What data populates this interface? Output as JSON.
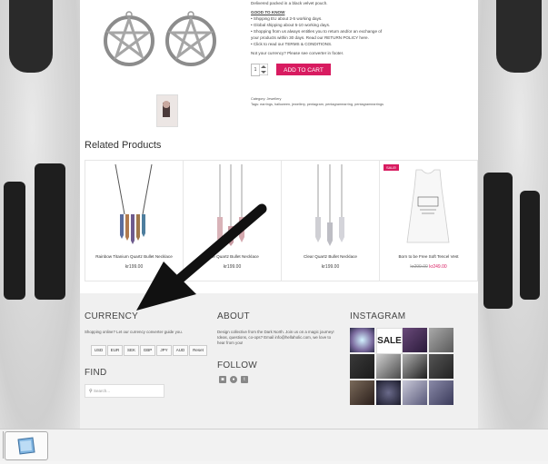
{
  "product": {
    "delivery_note": "Delivered packed in a black velvet pouch.",
    "good_to_know": "GOOD TO KNOW",
    "bullets": [
      "• Shipping EU about 2-5 working days.",
      "• Global shipping about 5-10 working days.",
      "• Shopping from us always entitles you to return and/or an exchange of your products within 30 days. Read our RETURN POLICY here.",
      "• Click to read our TERMS & CONDITIONS."
    ],
    "currency_note": "Not your currency? Please see converter in footer.",
    "quantity": "1",
    "add_to_cart": "ADD TO CART",
    "category": "Category: Jewellery",
    "tags": "Tags: earrings, halloween, jewellery, pentagram, pentagramearring, pentagramearrings"
  },
  "related": {
    "title": "Related Products",
    "items": [
      {
        "name": "Rainbow Titanium Quartz Bullet Necklace",
        "price": "kr199.00",
        "old_price": "",
        "sale": ""
      },
      {
        "name": "Rose Quartz Bullet Necklace",
        "price": "kr199.00",
        "old_price": "",
        "sale": ""
      },
      {
        "name": "Clear Quartz Bullet Necklace",
        "price": "kr199.00",
        "old_price": "",
        "sale": ""
      },
      {
        "name": "Born to be Free Soft Tencel Vest",
        "price": "kr249.00",
        "old_price": "kr299.00",
        "sale": "SALE!"
      }
    ]
  },
  "footer": {
    "currency": {
      "heading": "CURRENCY",
      "text": "Shopping online? Let our currency converter guide you.",
      "buttons": [
        "USD",
        "EUR",
        "SEK",
        "GBP",
        "JPY",
        "AUD",
        "Reset"
      ]
    },
    "find": {
      "heading": "FIND",
      "search_placeholder": "Search..."
    },
    "about": {
      "heading": "ABOUT",
      "text": "Design collective from the Dark North. Join us on a magic journey! Ideas, questions, co-ops? Email info@hellaholic.com, we love to hear from you!"
    },
    "follow": {
      "heading": "FOLLOW",
      "icons": [
        "instagram-icon",
        "pinterest-icon",
        "tumblr-icon"
      ],
      "glyphs": [
        "◙",
        "●",
        "t"
      ]
    },
    "instagram": {
      "heading": "INSTAGRAM",
      "sale_tile_text": "SALE"
    }
  },
  "colors": {
    "accent": "#d81b60"
  }
}
